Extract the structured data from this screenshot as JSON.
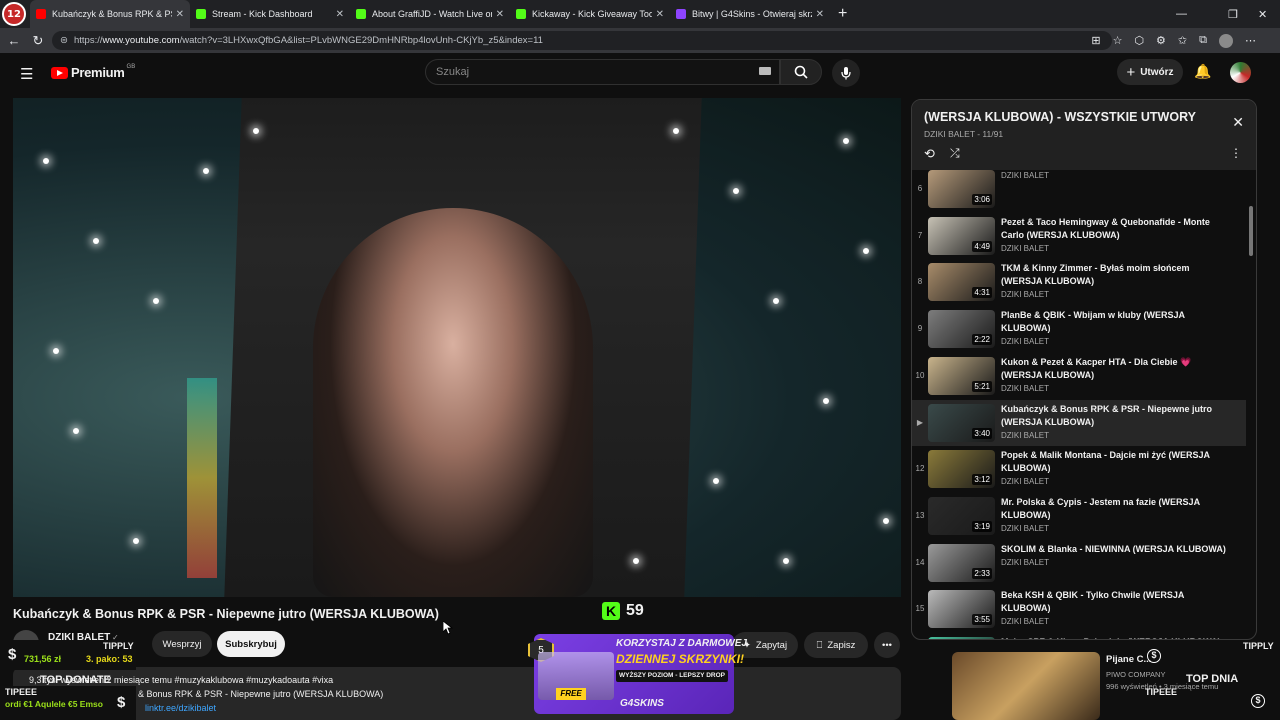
{
  "browser": {
    "tabs": [
      {
        "title": "Kubańczyk & Bonus RPK & PSR",
        "fav_color": "#ff0000",
        "active": true
      },
      {
        "title": "Stream - Kick Dashboard",
        "fav_color": "#53fc18",
        "active": false
      },
      {
        "title": "About GraffiJD - Watch Live on Kick",
        "fav_color": "#53fc18",
        "active": false
      },
      {
        "title": "Kickaway - Kick Giveaway Tool",
        "fav_color": "#53fc18",
        "active": false
      },
      {
        "title": "Bitwy | G4Skins - Otwieraj skrzynki",
        "fav_color": "#8e44ff",
        "active": false
      }
    ],
    "new_tab": "+",
    "url_prefix": "https://",
    "url_host": "www.youtube.com",
    "url_rest": "/watch?v=3LHXwxQfbGA&list=PLvbWNGE29DmHNRbp4lovUnh-CKjYb_z5&index=11"
  },
  "youtube": {
    "logo_text": "Premium",
    "logo_sup": "GB",
    "search_placeholder": "Szukaj",
    "create_label": "Utwórz"
  },
  "video": {
    "title": "Kubańczyk & Bonus RPK & PSR - Niepewne jutro (WERSJA KLUBOWA)",
    "channel": "DZIKI BALET",
    "support_label": "Wesprzyj",
    "subscribe_label": "Subskrybuj",
    "ask_label": "Zapytaj",
    "save_label": "Zapisz",
    "desc_line1": "9,3 tys. wyświetleń  2 miesiące temu  #muzykaklubowa #muzykadoauta #vixa",
    "desc_line2": "NOWOŚĆ: Kubańczyk & Bonus RPK & PSR - Niepewne jutro (WERSJA KLUBOWA)",
    "desc_line3": "linktr.ee/dzikibalet"
  },
  "playlist": {
    "title": "(WERSJA KLUBOWA) - WSZYSTKIE UTWORY",
    "subtitle": "DZIKI BALET - 11/91",
    "items": [
      {
        "num": "6",
        "title": "",
        "channel": "DZIKI BALET",
        "duration": "3:06",
        "color": "#b59a7a"
      },
      {
        "num": "7",
        "title": "Pezet & Taco Hemingway & Quebonafide - Monte Carlo (WERSJA KLUBOWA)",
        "channel": "DZIKI BALET",
        "duration": "4:49",
        "color": "#c7c2b5"
      },
      {
        "num": "8",
        "title": "TKM & Kinny Zimmer - Byłaś moim słońcem (WERSJA KLUBOWA)",
        "channel": "DZIKI BALET",
        "duration": "4:31",
        "color": "#a88c6a"
      },
      {
        "num": "9",
        "title": "PlanBe & QBIK - Wbijam w kluby (WERSJA KLUBOWA)",
        "channel": "DZIKI BALET",
        "duration": "2:22",
        "color": "#7d7d7d"
      },
      {
        "num": "10",
        "title": "Kukon & Pezet & Kacper HTA - Dla Ciebie 💗 (WERSJA KLUBOWA)",
        "channel": "DZIKI BALET",
        "duration": "5:21",
        "color": "#c9b48c"
      },
      {
        "num": "▶",
        "title": "Kubańczyk & Bonus RPK & PSR - Niepewne jutro (WERSJA KLUBOWA)",
        "channel": "DZIKI BALET",
        "duration": "3:40",
        "color": "#3a4a4a"
      },
      {
        "num": "12",
        "title": "Popek & Malik Montana - Dajcie mi żyć (WERSJA KLUBOWA)",
        "channel": "DZIKI BALET",
        "duration": "3:12",
        "color": "#8a7a3a"
      },
      {
        "num": "13",
        "title": "Mr. Polska & Cypis - Jestem na fazie (WERSJA KLUBOWA)",
        "channel": "DZIKI BALET",
        "duration": "3:19",
        "color": "#2a2a2a"
      },
      {
        "num": "14",
        "title": "SKOLIM & Blanka - NIEWINNA (WERSJA KLUBOWA)",
        "channel": "DZIKI BALET",
        "duration": "2:33",
        "color": "#9a9a9a"
      },
      {
        "num": "15",
        "title": "Beka KSH & QBIK - Tylko Chwile (WERSJA KLUBOWA)",
        "channel": "DZIKI BALET",
        "duration": "3:55",
        "color": "#bababa"
      },
      {
        "num": "16",
        "title": "Major SPZ & Kizo - Palę zioło (WERSJA KLUBOWA)",
        "channel": "",
        "duration": "",
        "color": "#4ac4a0"
      }
    ]
  },
  "recommended": {
    "title": "Pijane C...",
    "meta": "PIWO COMPANY",
    "views": "996 wyświetleń • 3 miesiące temu"
  },
  "overlays": {
    "kick_count": "59",
    "tipply_left": "TIPPLY",
    "tipply_right": "TIPPLY",
    "amount": "731,56 zł",
    "pako": "3. pako: 53",
    "top_donate": "TOP DONATE",
    "top_dnia": "TOP DNIA",
    "tipeee_left": "TIPEEE",
    "tipeee_right": "TIPEEE",
    "donors": "ordi  €1 Aqulele  €5 Emso",
    "ad_headline1": "KORZYSTAJ Z DARMOWEJ",
    "ad_headline2": "DZIENNEJ SKRZYNKI!",
    "ad_tagline": "WYŻSZY POZIOM - LEPSZY DROP",
    "ad_free": "FREE",
    "ad_badge": "5",
    "ad_brand": "G4SKINS"
  },
  "colors": {
    "yt_red": "#ff0000",
    "kick_green": "#53fc18",
    "ad_purple": "#7b3fe4",
    "ad_yellow": "#ffd21f"
  }
}
